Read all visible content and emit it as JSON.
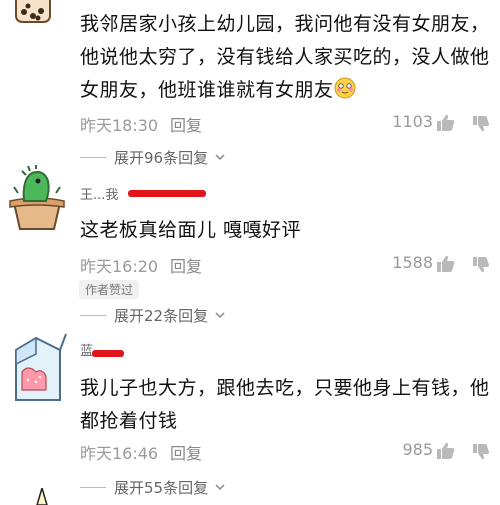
{
  "comments": [
    {
      "name_fragment": "ᆞᆢᆞ",
      "body_lines": [
        "我邻居家小孩上幼儿园，我问他有没有女朋友，",
        "他说他太穷了，没有钱给人家买吃的，没人做他",
        "女朋友，他班谁谁就有女朋友"
      ],
      "time": "昨天18:30",
      "reply_label": "回复",
      "likes": "1103",
      "expand_label": "展开96条回复"
    },
    {
      "name_visible": "王...我",
      "body_lines": [
        "这老板真给面儿  嘎嘎好评"
      ],
      "time": "昨天16:20",
      "reply_label": "回复",
      "likes": "1588",
      "author_tag": "作者赞过",
      "expand_label": "展开22条回复"
    },
    {
      "name_visible": "蓝",
      "body_lines": [
        "我儿子也大方，跟他去吃，只要他身上有钱，他",
        "都抢着付钱"
      ],
      "time": "昨天16:46",
      "reply_label": "回复",
      "likes": "985",
      "expand_label": "展开55条回复"
    }
  ],
  "colors": {
    "redact": "#e0161b",
    "meta": "#9a9a9a",
    "text": "#111111"
  }
}
